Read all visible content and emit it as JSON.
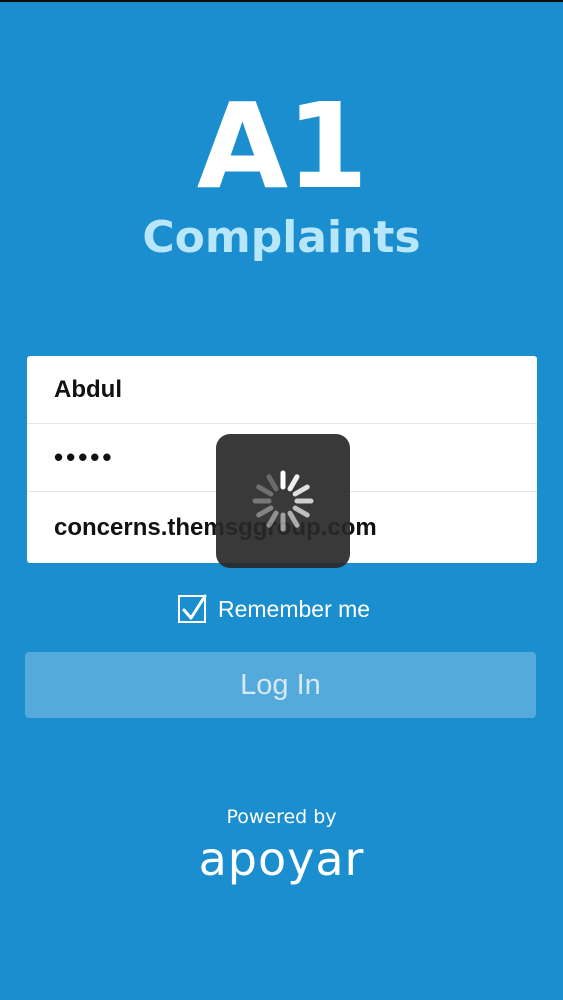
{
  "brand": {
    "title": "A1",
    "subtitle": "Complaints"
  },
  "form": {
    "username_value": "Abdul",
    "password_value": "•••••",
    "server_value": "concerns.themsggroup.com"
  },
  "remember": {
    "label": "Remember me",
    "checked": true
  },
  "login_button": {
    "label": "Log In"
  },
  "footer": {
    "powered_by": "Powered by",
    "logo_text": "apoyar"
  },
  "colors": {
    "background": "#1a8ecf",
    "subtitle": "#b8e6fb",
    "card": "#ffffff"
  },
  "icons": {
    "checkbox": "checkmark-icon",
    "loading": "spinner-icon"
  }
}
